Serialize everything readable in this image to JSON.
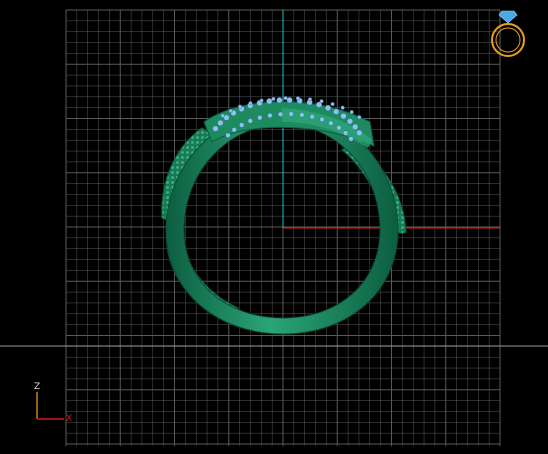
{
  "viewport": {
    "background": "#000000",
    "grid_color": "#5a5a5a",
    "horizon_color": "#9a9a9a",
    "axis_colors": {
      "vertical": "#1fc0c8",
      "horizontal": "#d21a1a"
    },
    "view": "front"
  },
  "model": {
    "name": "ring",
    "metal_color": "#1f8f65",
    "stone_color": "#8fc0f0"
  },
  "view_cube": {
    "icon": "ring-with-gem-icon",
    "ring_color": "#e8a020",
    "gem_color": "#4aa8e8"
  },
  "axis_triad": {
    "vertical_label": "Z",
    "horizontal_label": "X",
    "vertical_color": "#d08a20",
    "horizontal_color": "#d21a1a",
    "label_color": "#dddddd"
  }
}
